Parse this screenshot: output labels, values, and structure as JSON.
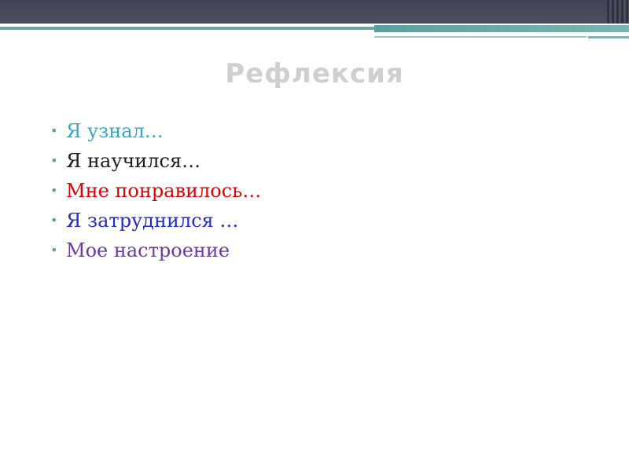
{
  "slide": {
    "title": "Рефлексия",
    "bullet_glyph": "•",
    "items": [
      {
        "text": "Я узнал…",
        "color": "#33a8c9"
      },
      {
        "text": "Я научился…",
        "color": "#1a1a2a"
      },
      {
        "text": "Мне понравилось…",
        "color": "#e00000"
      },
      {
        "text": "Я затруднился …",
        "color": "#1f2bd0"
      },
      {
        "text": "Мое настроение",
        "color": "#6a3aa0"
      }
    ]
  },
  "colors": {
    "header_bar": "#44485a",
    "accent_teal": "#6aa5a5",
    "title_gray": "#cfcfcf"
  }
}
